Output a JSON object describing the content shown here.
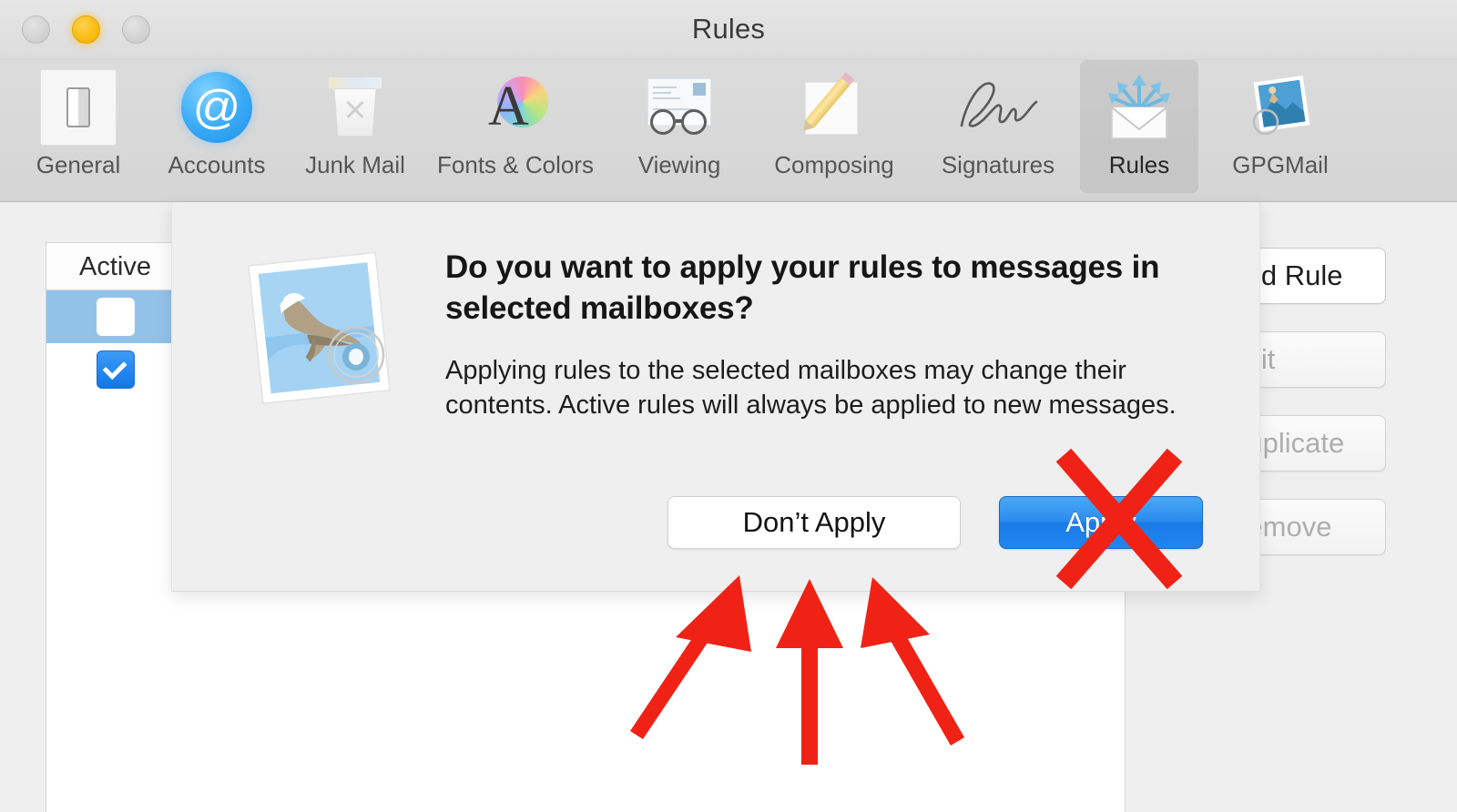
{
  "window": {
    "title": "Rules",
    "traffic_lights": [
      "close-button",
      "minimize-button",
      "zoom-button"
    ]
  },
  "toolbar": {
    "items": [
      {
        "label": "General",
        "icon": "general-icon",
        "selected": false
      },
      {
        "label": "Accounts",
        "icon": "at-sign-icon",
        "selected": false
      },
      {
        "label": "Junk Mail",
        "icon": "trash-can-icon",
        "selected": false
      },
      {
        "label": "Fonts & Colors",
        "icon": "font-color-icon",
        "selected": false
      },
      {
        "label": "Viewing",
        "icon": "eyeglasses-icon",
        "selected": false
      },
      {
        "label": "Composing",
        "icon": "pencil-icon",
        "selected": false
      },
      {
        "label": "Signatures",
        "icon": "signature-icon",
        "selected": false
      },
      {
        "label": "Rules",
        "icon": "rules-envelope-icon",
        "selected": true
      },
      {
        "label": "GPGMail",
        "icon": "gpgmail-stamp-icon",
        "selected": false
      }
    ]
  },
  "rules_list": {
    "columns": [
      "Active"
    ],
    "rows": [
      {
        "active": true,
        "selected": true
      },
      {
        "active": true,
        "selected": false
      }
    ]
  },
  "side_buttons": [
    {
      "label": "Add Rule",
      "primary": true,
      "enabled": true
    },
    {
      "label": "Edit",
      "primary": false,
      "enabled": false
    },
    {
      "label": "Duplicate",
      "primary": false,
      "enabled": false
    },
    {
      "label": "Remove",
      "primary": false,
      "enabled": false
    }
  ],
  "dialog": {
    "icon": "mail-stamp-icon",
    "title": "Do you want to apply your rules to messages in selected mailboxes?",
    "message": "Applying rules to the selected mailboxes may change their contents. Active rules will always be applied to new messages.",
    "buttons": {
      "secondary": "Don’t Apply",
      "primary": "Apply"
    }
  },
  "annotations": {
    "color": "#f02216",
    "cross_over": "Apply",
    "arrow_count": 3,
    "arrows_point_at": "Don’t Apply"
  }
}
